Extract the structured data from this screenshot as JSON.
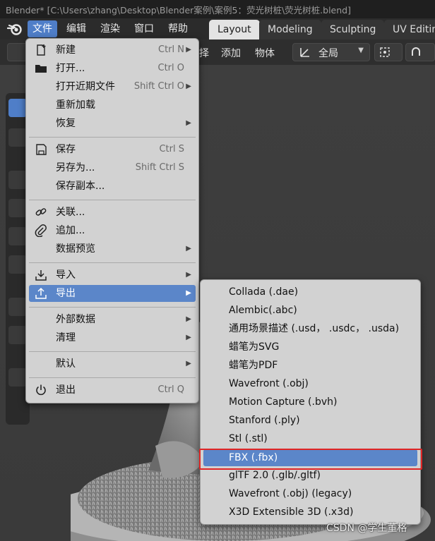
{
  "window": {
    "title": "Blender* [C:\\Users\\zhang\\Desktop\\Blender案例\\案例5：荧光树桩\\荧光树桩.blend]"
  },
  "menubar": {
    "items": [
      {
        "label": "文件",
        "active": true
      },
      {
        "label": "编辑"
      },
      {
        "label": "渲染"
      },
      {
        "label": "窗口"
      },
      {
        "label": "帮助"
      }
    ]
  },
  "workspaces": {
    "tabs": [
      {
        "label": "Layout",
        "active": true
      },
      {
        "label": "Modeling"
      },
      {
        "label": "Sculpting"
      },
      {
        "label": "UV Editin"
      }
    ]
  },
  "header": {
    "partial_text": "择",
    "add_label": "添加",
    "object_label": "物体",
    "orientation_value": "全局"
  },
  "file_menu": {
    "items": [
      {
        "label": "新建",
        "shortcut": "Ctrl N",
        "icon": "new-file-icon",
        "submenu": true
      },
      {
        "label": "打开...",
        "shortcut": "Ctrl O",
        "icon": "folder-icon"
      },
      {
        "label": "打开近期文件",
        "shortcut": "Shift Ctrl O",
        "submenu": true
      },
      {
        "label": "重新加载"
      },
      {
        "label": "恢复",
        "submenu": true
      },
      {
        "label": "保存",
        "shortcut": "Ctrl S",
        "icon": "save-icon"
      },
      {
        "label": "另存为...",
        "shortcut": "Shift Ctrl S"
      },
      {
        "label": "保存副本..."
      },
      {
        "label": "关联...",
        "icon": "link-icon"
      },
      {
        "label": "追加...",
        "icon": "append-icon"
      },
      {
        "label": "数据预览",
        "submenu": true
      },
      {
        "label": "导入",
        "icon": "import-icon",
        "submenu": true
      },
      {
        "label": "导出",
        "icon": "export-icon",
        "submenu": true,
        "highlighted": true
      },
      {
        "label": "外部数据",
        "submenu": true
      },
      {
        "label": "清理",
        "submenu": true
      },
      {
        "label": "默认",
        "submenu": true
      },
      {
        "label": "退出",
        "shortcut": "Ctrl Q",
        "icon": "power-icon"
      }
    ]
  },
  "export_menu": {
    "items": [
      {
        "label": "Collada (.dae)"
      },
      {
        "label": "Alembic(.abc)"
      },
      {
        "label": "通用场景描述 (.usd， .usdc， .usda)"
      },
      {
        "label": "蜡笔为SVG"
      },
      {
        "label": "蜡笔为PDF"
      },
      {
        "label": "Wavefront (.obj)"
      },
      {
        "label": "Motion Capture (.bvh)"
      },
      {
        "label": "Stanford (.ply)"
      },
      {
        "label": "Stl (.stl)"
      },
      {
        "label": "FBX (.fbx)",
        "highlighted": true
      },
      {
        "label": "glTF 2.0 (.glb/.gltf)"
      },
      {
        "label": "Wavefront (.obj) (legacy)"
      },
      {
        "label": "X3D Extensible 3D (.x3d)"
      }
    ]
  },
  "watermark": "CSDN @学生董格",
  "colors": {
    "accent": "#4f7ec8",
    "menu_highlight": "#5b86c9",
    "menu_bg": "#d2d2d2",
    "annotation_red": "#e02525"
  }
}
